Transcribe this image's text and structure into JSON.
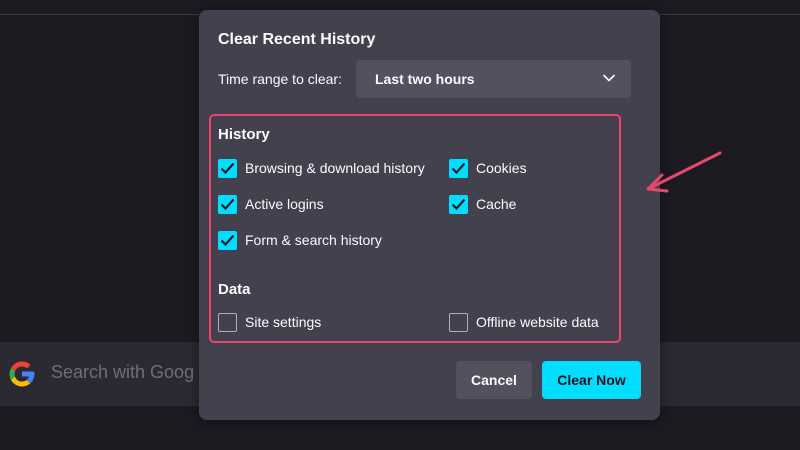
{
  "background": {
    "search_placeholder": "Search with Goog",
    "search_icon": "google-g-icon"
  },
  "dialog": {
    "title": "Clear Recent History",
    "time_range_label": "Time range to clear:",
    "time_range_value": "Last two hours",
    "history_heading": "History",
    "history_items": [
      {
        "label": "Browsing & download history",
        "checked": true
      },
      {
        "label": "Cookies",
        "checked": true
      },
      {
        "label": "Active logins",
        "checked": true
      },
      {
        "label": "Cache",
        "checked": true
      },
      {
        "label": "Form & search history",
        "checked": true
      }
    ],
    "data_heading": "Data",
    "data_items": [
      {
        "label": "Site settings",
        "checked": false
      },
      {
        "label": "Offline website data",
        "checked": false
      }
    ],
    "cancel_label": "Cancel",
    "clear_label": "Clear Now"
  },
  "colors": {
    "accent": "#00ddff",
    "highlight": "#e8466c",
    "dialog_bg": "#42414d"
  }
}
